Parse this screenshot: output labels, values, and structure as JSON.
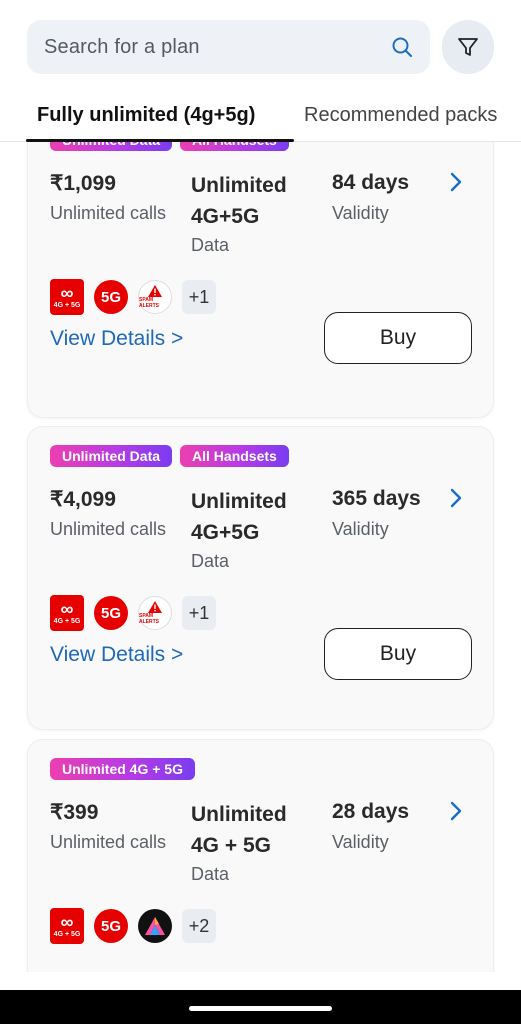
{
  "search": {
    "placeholder": "Search for a plan"
  },
  "tabs": [
    {
      "label": "Fully unlimited (4g+5g)",
      "active": true
    },
    {
      "label": "Recommended packs",
      "active": false
    }
  ],
  "plans": [
    {
      "tags": [
        "Unlimited Data",
        "All Handsets"
      ],
      "price": "₹1,099",
      "price_sub": "Unlimited calls",
      "data_line1": "Unlimited",
      "data_line2": "4G+5G",
      "data_sub": "Data",
      "validity": "84 days",
      "validity_sub": "Validity",
      "icons": [
        "unlimited-4g5g-icon",
        "5g-icon",
        "spam-alerts-icon"
      ],
      "more": "+1",
      "view_details": "View Details >",
      "buy": "Buy"
    },
    {
      "tags": [
        "Unlimited Data",
        "All Handsets"
      ],
      "price": "₹4,099",
      "price_sub": "Unlimited calls",
      "data_line1": "Unlimited",
      "data_line2": "4G+5G",
      "data_sub": "Data",
      "validity": "365 days",
      "validity_sub": "Validity",
      "icons": [
        "unlimited-4g5g-icon",
        "5g-icon",
        "spam-alerts-icon"
      ],
      "more": "+1",
      "view_details": "View Details >",
      "buy": "Buy"
    },
    {
      "tags": [
        "Unlimited 4G + 5G"
      ],
      "price": "₹399",
      "price_sub": "Unlimited calls",
      "data_line1": "Unlimited",
      "data_line2": "4G + 5G",
      "data_sub": "Data",
      "validity": "28 days",
      "validity_sub": "Validity",
      "icons": [
        "unlimited-4g5g-icon",
        "5g-icon",
        "app-a-icon"
      ],
      "more": "+2",
      "view_details": "",
      "buy": ""
    }
  ],
  "icon_labels": {
    "unlimited": "4G + 5G",
    "fiveg": "5G",
    "spam": "SPAM ALERTS"
  },
  "colors": {
    "brand_red": "#e60000",
    "link_blue": "#1e69b8",
    "tag_gradient_start": "#ec3fb0",
    "tag_gradient_end": "#7a3cf0"
  }
}
